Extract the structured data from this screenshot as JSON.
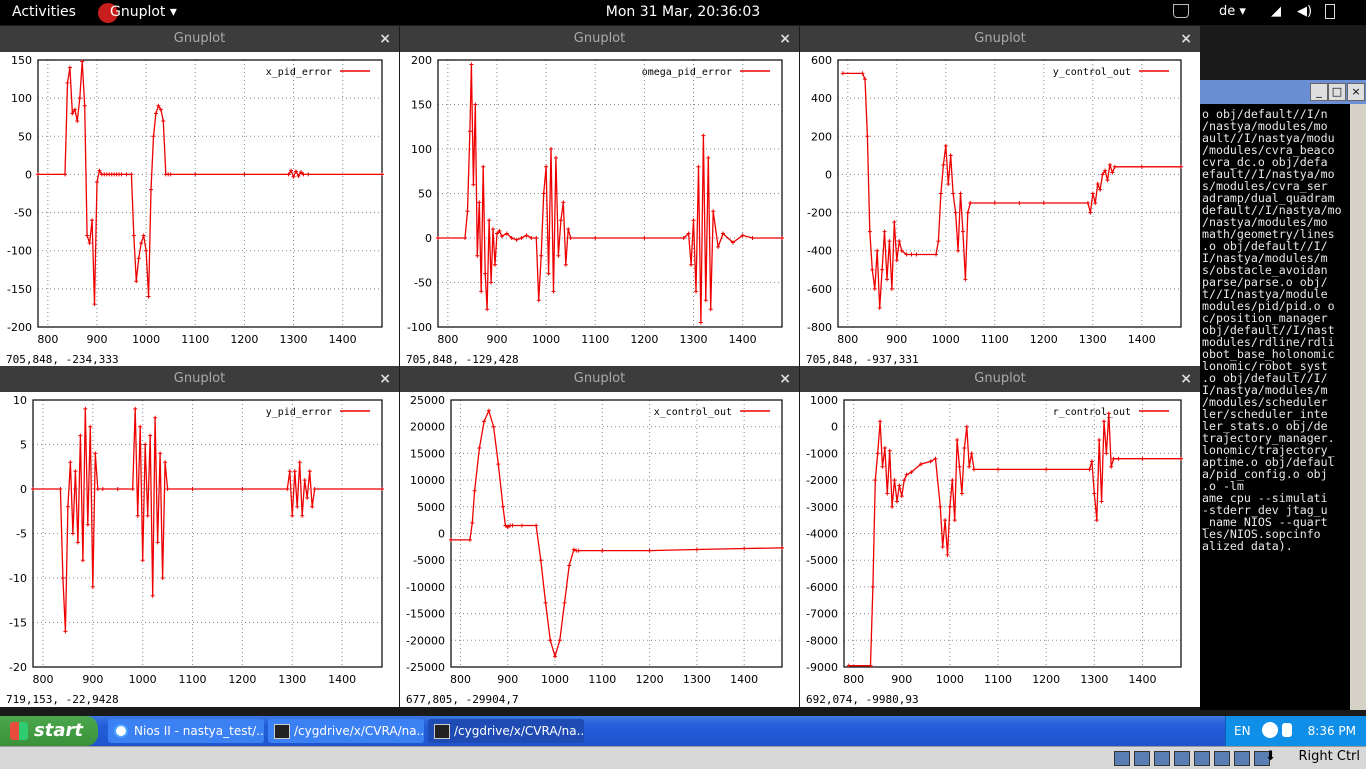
{
  "topbar": {
    "activities": "Activities",
    "app_menu": "Gnuplot",
    "clock": "Mon 31 Mar, 20:36:03",
    "language": "de",
    "language_arrow": "▾",
    "wifi_glyph": "◢",
    "volume_glyph": "◀)"
  },
  "windows": [
    {
      "title": "Gnuplot",
      "close": "×",
      "legend": "x_pid_error",
      "status": "705,848, -234,333",
      "chart": {
        "type": "line",
        "xlim": [
          780,
          1480
        ],
        "ylim": [
          -200,
          150
        ],
        "xticks": [
          800,
          900,
          1000,
          1100,
          1200,
          1300,
          1400
        ],
        "yticks": [
          -200,
          -150,
          -100,
          -50,
          0,
          50,
          100,
          150
        ],
        "grid": true,
        "legend_position": "top-right",
        "x": [
          780,
          835,
          840,
          845,
          850,
          855,
          860,
          865,
          870,
          875,
          880,
          885,
          890,
          895,
          900,
          905,
          910,
          915,
          920,
          925,
          930,
          935,
          940,
          945,
          950,
          960,
          970,
          975,
          980,
          985,
          990,
          995,
          1000,
          1005,
          1010,
          1015,
          1020,
          1025,
          1030,
          1035,
          1040,
          1045,
          1050,
          1100,
          1200,
          1290,
          1295,
          1300,
          1305,
          1310,
          1315,
          1320,
          1330,
          1480
        ],
        "y": [
          0,
          0,
          120,
          140,
          80,
          85,
          70,
          100,
          148,
          90,
          -80,
          -90,
          -60,
          -170,
          -10,
          5,
          0,
          0,
          0,
          0,
          0,
          0,
          0,
          0,
          0,
          0,
          0,
          -80,
          -140,
          -110,
          -90,
          -80,
          -100,
          -160,
          -20,
          50,
          80,
          90,
          85,
          70,
          0,
          0,
          0,
          0,
          0,
          0,
          5,
          -3,
          4,
          -2,
          3,
          0,
          0,
          0
        ]
      }
    },
    {
      "title": "Gnuplot",
      "close": "×",
      "legend": "omega_pid_error",
      "status": "705,848, -129,428",
      "chart": {
        "type": "line",
        "xlim": [
          780,
          1480
        ],
        "ylim": [
          -100,
          200
        ],
        "xticks": [
          800,
          900,
          1000,
          1100,
          1200,
          1300,
          1400
        ],
        "yticks": [
          -100,
          -50,
          0,
          50,
          100,
          150,
          200
        ],
        "grid": true,
        "legend_position": "top-right",
        "x": [
          780,
          835,
          840,
          845,
          848,
          852,
          856,
          860,
          864,
          868,
          872,
          876,
          880,
          884,
          888,
          892,
          896,
          900,
          905,
          910,
          920,
          930,
          940,
          950,
          960,
          970,
          980,
          985,
          990,
          995,
          1000,
          1005,
          1010,
          1015,
          1020,
          1025,
          1030,
          1035,
          1040,
          1045,
          1050,
          1100,
          1200,
          1280,
          1290,
          1295,
          1300,
          1305,
          1310,
          1315,
          1320,
          1325,
          1330,
          1335,
          1340,
          1350,
          1360,
          1380,
          1400,
          1420,
          1480
        ],
        "y": [
          0,
          0,
          30,
          120,
          195,
          60,
          150,
          -20,
          40,
          -60,
          80,
          -40,
          -80,
          20,
          -50,
          10,
          -30,
          5,
          8,
          2,
          5,
          0,
          -2,
          0,
          3,
          0,
          0,
          -70,
          -20,
          50,
          80,
          -40,
          100,
          -60,
          90,
          -20,
          20,
          40,
          -30,
          10,
          0,
          0,
          0,
          0,
          5,
          -30,
          20,
          -60,
          80,
          -95,
          115,
          -70,
          90,
          -80,
          30,
          -10,
          5,
          -5,
          3,
          0,
          0
        ]
      }
    },
    {
      "title": "Gnuplot",
      "close": "×",
      "legend": "y_control_out",
      "status": "705,848, -937,331",
      "chart": {
        "type": "line",
        "xlim": [
          780,
          1480
        ],
        "ylim": [
          -800,
          600
        ],
        "xticks": [
          800,
          900,
          1000,
          1100,
          1200,
          1300,
          1400
        ],
        "yticks": [
          -800,
          -600,
          -400,
          -200,
          0,
          200,
          400,
          600
        ],
        "grid": true,
        "legend_position": "top-right",
        "x": [
          790,
          830,
          835,
          840,
          845,
          850,
          855,
          860,
          865,
          870,
          875,
          880,
          885,
          890,
          895,
          900,
          905,
          910,
          920,
          930,
          940,
          980,
          985,
          990,
          995,
          1000,
          1005,
          1010,
          1015,
          1020,
          1025,
          1030,
          1035,
          1040,
          1045,
          1050,
          1100,
          1150,
          1200,
          1290,
          1295,
          1300,
          1305,
          1310,
          1315,
          1320,
          1325,
          1330,
          1335,
          1340,
          1345,
          1400,
          1480
        ],
        "y": [
          530,
          530,
          500,
          200,
          -300,
          -500,
          -600,
          -400,
          -700,
          -500,
          -300,
          -550,
          -350,
          -600,
          -250,
          -450,
          -350,
          -400,
          -420,
          -420,
          -420,
          -420,
          -350,
          -100,
          50,
          150,
          -50,
          100,
          -100,
          -200,
          -400,
          -100,
          -300,
          -550,
          -200,
          -150,
          -150,
          -150,
          -150,
          -150,
          -200,
          -100,
          -150,
          -50,
          -80,
          0,
          20,
          -30,
          50,
          10,
          40,
          40,
          40
        ]
      }
    },
    {
      "title": "Gnuplot",
      "close": "×",
      "legend": "y_pid_error",
      "status": "719,153, -22,9428",
      "chart": {
        "type": "line",
        "xlim": [
          780,
          1480
        ],
        "ylim": [
          -20,
          10
        ],
        "xticks": [
          800,
          900,
          1000,
          1100,
          1200,
          1300,
          1400
        ],
        "yticks": [
          -20,
          -15,
          -10,
          -5,
          0,
          5,
          10
        ],
        "grid": true,
        "legend_position": "top-right",
        "x": [
          780,
          835,
          840,
          845,
          850,
          855,
          860,
          865,
          870,
          875,
          880,
          885,
          890,
          895,
          900,
          905,
          910,
          920,
          950,
          980,
          985,
          990,
          995,
          1000,
          1005,
          1010,
          1015,
          1020,
          1025,
          1030,
          1035,
          1040,
          1045,
          1050,
          1100,
          1200,
          1290,
          1295,
          1300,
          1305,
          1310,
          1315,
          1320,
          1325,
          1330,
          1335,
          1340,
          1345,
          1480
        ],
        "y": [
          0,
          0,
          -10,
          -16,
          -2,
          3,
          -5,
          2,
          -6,
          6,
          -8,
          9,
          -4,
          7,
          -11,
          4,
          0,
          0,
          0,
          0,
          9,
          -3,
          7,
          -8,
          5,
          -3,
          6,
          -12,
          8,
          -6,
          4,
          -10,
          3,
          0,
          0,
          0,
          0,
          2,
          -3,
          2,
          -2,
          3,
          -3,
          1,
          -1,
          2,
          -2,
          0,
          0
        ]
      }
    },
    {
      "title": "Gnuplot",
      "close": "×",
      "legend": "x_control_out",
      "status": "677,805, -29904,7",
      "chart": {
        "type": "line",
        "xlim": [
          780,
          1480
        ],
        "ylim": [
          -25000,
          25000
        ],
        "xticks": [
          800,
          900,
          1000,
          1100,
          1200,
          1300,
          1400
        ],
        "yticks": [
          -25000,
          -20000,
          -15000,
          -10000,
          -5000,
          0,
          5000,
          10000,
          15000,
          20000,
          25000
        ],
        "grid": true,
        "legend_position": "top-right",
        "x": [
          780,
          820,
          825,
          830,
          840,
          850,
          860,
          870,
          880,
          890,
          895,
          900,
          905,
          910,
          930,
          960,
          970,
          980,
          990,
          1000,
          1010,
          1020,
          1030,
          1040,
          1045,
          1050,
          1100,
          1200,
          1300,
          1400,
          1480
        ],
        "y": [
          -1200,
          -1200,
          2000,
          8000,
          16000,
          21000,
          23000,
          20000,
          13000,
          5000,
          1500,
          1200,
          1500,
          1500,
          1500,
          1500,
          -5000,
          -13000,
          -20000,
          -23000,
          -20000,
          -13000,
          -6000,
          -3000,
          -3200,
          -3200,
          -3200,
          -3200,
          -3000,
          -2800,
          -2700
        ]
      }
    },
    {
      "title": "Gnuplot",
      "close": "×",
      "legend": "r_control_out",
      "status": "692,074, -9980,93",
      "chart": {
        "type": "line",
        "xlim": [
          780,
          1480
        ],
        "ylim": [
          -9000,
          1000
        ],
        "xticks": [
          800,
          900,
          1000,
          1100,
          1200,
          1300,
          1400
        ],
        "yticks": [
          -9000,
          -8000,
          -7000,
          -6000,
          -5000,
          -4000,
          -3000,
          -2000,
          -1000,
          0,
          1000
        ],
        "grid": true,
        "legend_position": "top-right",
        "x": [
          790,
          835,
          840,
          845,
          850,
          855,
          860,
          865,
          870,
          875,
          880,
          885,
          890,
          895,
          900,
          905,
          910,
          920,
          940,
          960,
          970,
          980,
          985,
          990,
          995,
          1000,
          1005,
          1010,
          1015,
          1020,
          1025,
          1030,
          1035,
          1040,
          1045,
          1050,
          1100,
          1200,
          1290,
          1295,
          1300,
          1305,
          1310,
          1315,
          1320,
          1325,
          1330,
          1335,
          1340,
          1350,
          1400,
          1480
        ],
        "y": [
          -8950,
          -8950,
          -6000,
          -2000,
          -1000,
          200,
          -1500,
          -800,
          -2500,
          -900,
          -3000,
          -2000,
          -2800,
          -2200,
          -2600,
          -2000,
          -1800,
          -1700,
          -1400,
          -1300,
          -1200,
          -3000,
          -4500,
          -3500,
          -4800,
          -3000,
          -2000,
          -3500,
          -500,
          -1500,
          -2500,
          -800,
          0,
          -1500,
          -1000,
          -1600,
          -1600,
          -1600,
          -1600,
          -1300,
          -2500,
          -3500,
          -500,
          -2800,
          200,
          -1000,
          500,
          -1500,
          -1200,
          -1200,
          -1200,
          -1200
        ]
      }
    }
  ],
  "terminal": {
    "lines": [
      "o obj/default//I/n",
      "/nastya/modules/mo",
      "ault//I/nastya/modu",
      "/modules/cvra_beaco",
      "cvra_dc.o obj/defa",
      "efault//I/nastya/mo",
      "s/modules/cvra_ser",
      "adramp/dual_quadram",
      "default//I/nastya/mo",
      "/nastya/modules/mo",
      "math/geometry/lines",
      ".o obj/default//I/",
      "I/nastya/modules/m",
      "s/obstacle_avoidan",
      "parse/parse.o obj/",
      "t//I/nastya/module",
      "modules/pid/pid.o o",
      "c/position_manager",
      "obj/default//I/nast",
      "modules/rdline/rdli",
      "obot_base_holonomic",
      "lonomic/robot_syst",
      ".o obj/default//I/",
      "I/nastya/modules/m",
      "/modules/scheduler",
      "ler/scheduler_inte",
      "ler_stats.o obj/de",
      "trajectory_manager.",
      "lonomic/trajectory_",
      "aptime.o obj/defaul",
      "a/pid_config.o obj",
      ".o -lm",
      "ame cpu --simulati",
      "-stderr_dev jtag_u",
      "_name NIOS --quart",
      "les/NIOS.sopcinfo",
      "alized data)."
    ],
    "buttons": [
      "_",
      "□",
      "×"
    ]
  },
  "taskbar": {
    "start": "start",
    "tasks": [
      "Nios II - nastya_test/...",
      "/cygdrive/x/CVRA/na...",
      "/cygdrive/x/CVRA/na..."
    ],
    "lang": "EN",
    "time": "8:36 PM"
  },
  "vbox": {
    "host_key": "Right Ctrl",
    "arrow": "⬇"
  }
}
